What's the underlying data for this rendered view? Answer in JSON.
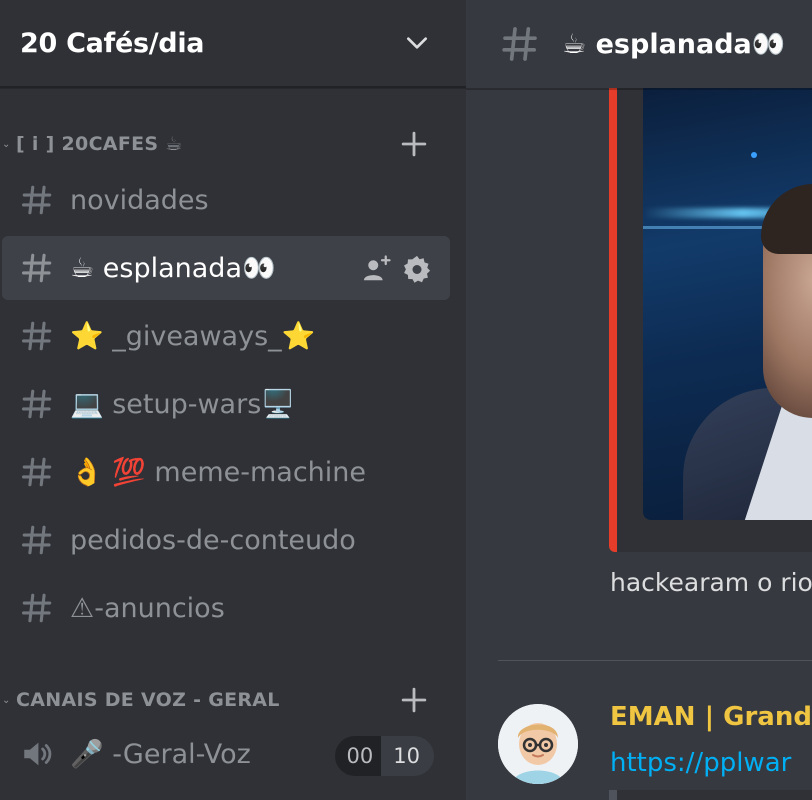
{
  "server": {
    "name": "20 Cafés/dia"
  },
  "categories": [
    {
      "label": "[ i ] 20CAFES ☕"
    },
    {
      "label": "CANAIS DE VOZ - GERAL"
    }
  ],
  "channels": [
    {
      "label": "novidades"
    },
    {
      "label": "☕ esplanada👀"
    },
    {
      "label": "⭐ _giveaways_⭐"
    },
    {
      "label": "💻 setup-wars🖥️"
    },
    {
      "label": "👌 💯 meme-machine"
    },
    {
      "label": "pedidos-de-conteudo"
    },
    {
      "label": "⚠-anuncios"
    }
  ],
  "voice_channels": [
    {
      "label": "🎤 -Geral-Voz",
      "current": "00",
      "max": "10"
    }
  ],
  "main": {
    "channel_title": "☕ esplanada👀",
    "message_text": "hackearam o rio",
    "second_message": {
      "author": "EMAN | Grande",
      "link": "https://pplwar"
    }
  },
  "colors": {
    "sidebar_bg": "#2f3136",
    "main_bg": "#36393f",
    "embed_accent": "#e53d29",
    "author_color": "#f0c541",
    "link_color": "#00aff4"
  }
}
